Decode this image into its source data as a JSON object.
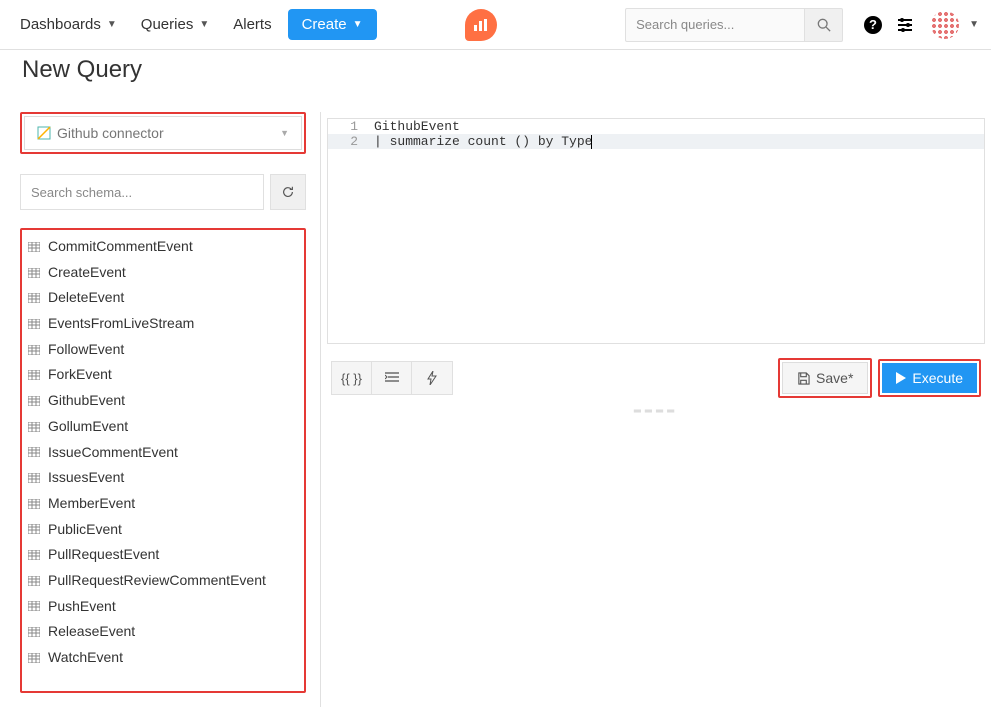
{
  "topnav": {
    "dashboards": "Dashboards",
    "queries": "Queries",
    "alerts": "Alerts",
    "create": "Create"
  },
  "search": {
    "placeholder": "Search queries..."
  },
  "page": {
    "title": "New Query"
  },
  "datasource": {
    "label": "Github connector"
  },
  "schema_search": {
    "placeholder": "Search schema..."
  },
  "tables": [
    "CommitCommentEvent",
    "CreateEvent",
    "DeleteEvent",
    "EventsFromLiveStream",
    "FollowEvent",
    "ForkEvent",
    "GithubEvent",
    "GollumEvent",
    "IssueCommentEvent",
    "IssuesEvent",
    "MemberEvent",
    "PublicEvent",
    "PullRequestEvent",
    "PullRequestReviewCommentEvent",
    "PushEvent",
    "ReleaseEvent",
    "WatchEvent"
  ],
  "editor": {
    "lines": [
      {
        "num": "1",
        "text": "GithubEvent"
      },
      {
        "num": "2",
        "text": "| summarize count () by Type"
      }
    ]
  },
  "toolbar": {
    "params": "{{ }}",
    "save": "Save*",
    "execute": "Execute"
  }
}
